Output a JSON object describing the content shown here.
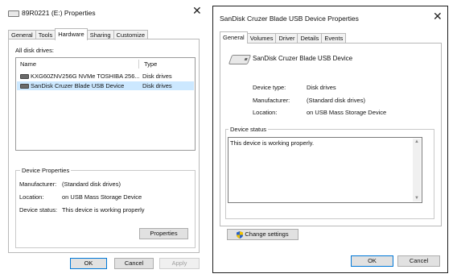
{
  "left": {
    "title": "89R0221 (E:) Properties",
    "tabs": [
      "General",
      "Tools",
      "Hardware",
      "Sharing",
      "Customize"
    ],
    "active_tab": "Hardware",
    "all_disk_drives_label": "All disk drives:",
    "columns": [
      "Name",
      "Type"
    ],
    "drives": [
      {
        "name": "KXG60ZNV256G NVMe TOSHIBA 256...",
        "type": "Disk drives"
      },
      {
        "name": "SanDisk Cruzer Blade USB Device",
        "type": "Disk drives"
      }
    ],
    "device_properties": {
      "title": "Device Properties",
      "manufacturer_label": "Manufacturer:",
      "manufacturer_value": "(Standard disk drives)",
      "location_label": "Location:",
      "location_value": "on USB Mass Storage Device",
      "status_label": "Device status:",
      "status_value": "This device is working properly",
      "properties_button": "Properties"
    },
    "buttons": {
      "ok": "OK",
      "cancel": "Cancel",
      "apply": "Apply"
    }
  },
  "right": {
    "title": "SanDisk Cruzer Blade USB Device Properties",
    "tabs": [
      "General",
      "Volumes",
      "Driver",
      "Details",
      "Events"
    ],
    "active_tab": "General",
    "device_name": "SanDisk Cruzer Blade USB Device",
    "device_type_label": "Device type:",
    "device_type_value": "Disk drives",
    "manufacturer_label": "Manufacturer:",
    "manufacturer_value": "(Standard disk drives)",
    "location_label": "Location:",
    "location_value": "on USB Mass Storage Device",
    "device_status_label": "Device status",
    "device_status_text": "This device is working properly.",
    "change_settings_button": "Change settings",
    "buttons": {
      "ok": "OK",
      "cancel": "Cancel"
    }
  }
}
